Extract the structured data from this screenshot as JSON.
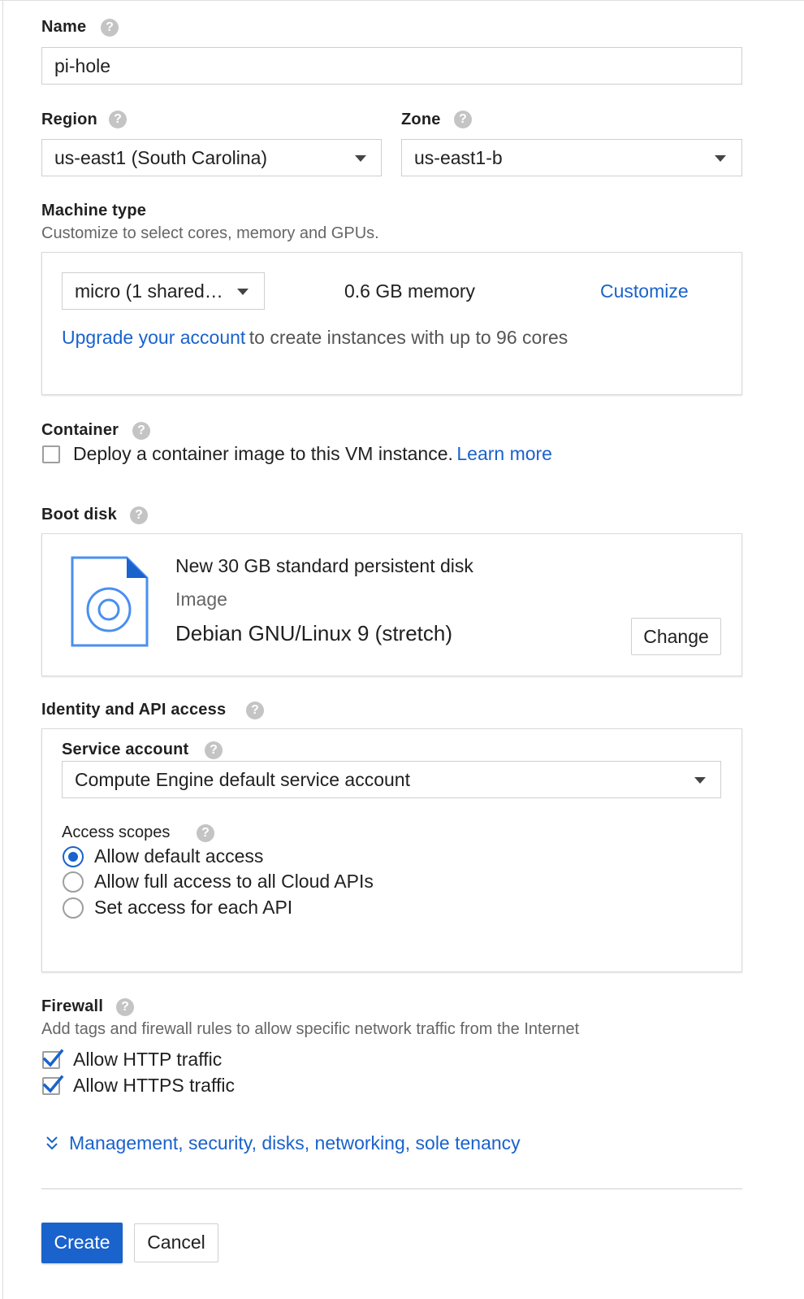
{
  "name": {
    "label": "Name",
    "value": "pi-hole"
  },
  "region": {
    "label": "Region",
    "value": "us-east1 (South Carolina)"
  },
  "zone": {
    "label": "Zone",
    "value": "us-east1-b"
  },
  "machine_type": {
    "label": "Machine type",
    "subtitle": "Customize to select cores, memory and GPUs.",
    "select_value": "micro (1 shared…",
    "memory": "0.6 GB memory",
    "customize_link": "Customize",
    "upgrade_link": "Upgrade your account",
    "upgrade_text": "to create instances with up to 96 cores"
  },
  "container": {
    "label": "Container",
    "checkbox_text": "Deploy a container image to this VM instance.",
    "learn_more": "Learn more",
    "checked": false
  },
  "boot_disk": {
    "label": "Boot disk",
    "disk_title": "New 30 GB standard persistent disk",
    "image_label": "Image",
    "image_name": "Debian GNU/Linux 9 (stretch)",
    "change_button": "Change"
  },
  "identity": {
    "label": "Identity and API access",
    "service_account_label": "Service account",
    "service_account_value": "Compute Engine default service account",
    "access_scopes_label": "Access scopes",
    "scopes": [
      {
        "label": "Allow default access",
        "selected": true
      },
      {
        "label": "Allow full access to all Cloud APIs",
        "selected": false
      },
      {
        "label": "Set access for each API",
        "selected": false
      }
    ]
  },
  "firewall": {
    "label": "Firewall",
    "subtitle": "Add tags and firewall rules to allow specific network traffic from the Internet",
    "options": [
      {
        "label": "Allow HTTP traffic",
        "checked": true
      },
      {
        "label": "Allow HTTPS traffic",
        "checked": true
      }
    ]
  },
  "advanced_link": "Management, security, disks, networking, sole tenancy",
  "actions": {
    "create": "Create",
    "cancel": "Cancel"
  },
  "colors": {
    "accent": "#1a62cc",
    "text": "#212121",
    "muted": "#666666",
    "border": "#cfcfcf"
  },
  "icons": {
    "help": "help-circle-icon",
    "dropdown": "caret-down-icon",
    "disk": "disk-image-icon",
    "check": "check-icon",
    "expand": "double-chevron-down-icon"
  }
}
